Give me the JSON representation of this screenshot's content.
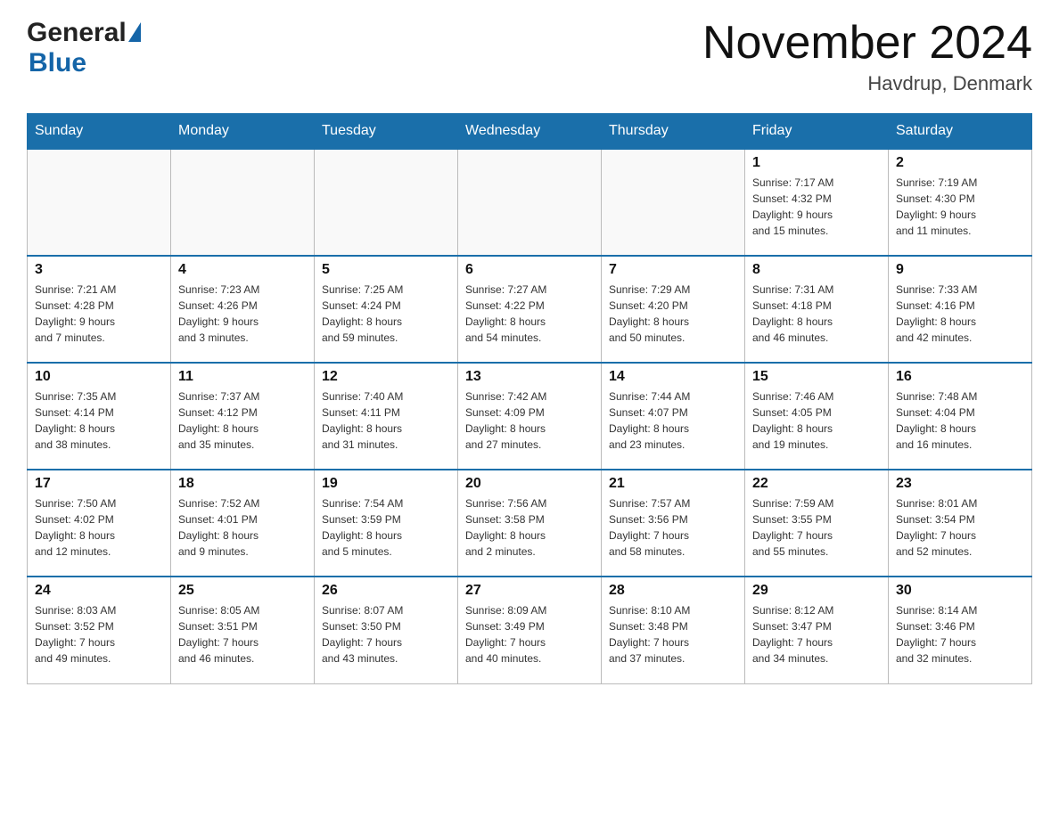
{
  "header": {
    "logo_general": "General",
    "logo_blue": "Blue",
    "month_year": "November 2024",
    "location": "Havdrup, Denmark"
  },
  "weekdays": [
    "Sunday",
    "Monday",
    "Tuesday",
    "Wednesday",
    "Thursday",
    "Friday",
    "Saturday"
  ],
  "weeks": [
    [
      {
        "day": "",
        "info": ""
      },
      {
        "day": "",
        "info": ""
      },
      {
        "day": "",
        "info": ""
      },
      {
        "day": "",
        "info": ""
      },
      {
        "day": "",
        "info": ""
      },
      {
        "day": "1",
        "info": "Sunrise: 7:17 AM\nSunset: 4:32 PM\nDaylight: 9 hours\nand 15 minutes."
      },
      {
        "day": "2",
        "info": "Sunrise: 7:19 AM\nSunset: 4:30 PM\nDaylight: 9 hours\nand 11 minutes."
      }
    ],
    [
      {
        "day": "3",
        "info": "Sunrise: 7:21 AM\nSunset: 4:28 PM\nDaylight: 9 hours\nand 7 minutes."
      },
      {
        "day": "4",
        "info": "Sunrise: 7:23 AM\nSunset: 4:26 PM\nDaylight: 9 hours\nand 3 minutes."
      },
      {
        "day": "5",
        "info": "Sunrise: 7:25 AM\nSunset: 4:24 PM\nDaylight: 8 hours\nand 59 minutes."
      },
      {
        "day": "6",
        "info": "Sunrise: 7:27 AM\nSunset: 4:22 PM\nDaylight: 8 hours\nand 54 minutes."
      },
      {
        "day": "7",
        "info": "Sunrise: 7:29 AM\nSunset: 4:20 PM\nDaylight: 8 hours\nand 50 minutes."
      },
      {
        "day": "8",
        "info": "Sunrise: 7:31 AM\nSunset: 4:18 PM\nDaylight: 8 hours\nand 46 minutes."
      },
      {
        "day": "9",
        "info": "Sunrise: 7:33 AM\nSunset: 4:16 PM\nDaylight: 8 hours\nand 42 minutes."
      }
    ],
    [
      {
        "day": "10",
        "info": "Sunrise: 7:35 AM\nSunset: 4:14 PM\nDaylight: 8 hours\nand 38 minutes."
      },
      {
        "day": "11",
        "info": "Sunrise: 7:37 AM\nSunset: 4:12 PM\nDaylight: 8 hours\nand 35 minutes."
      },
      {
        "day": "12",
        "info": "Sunrise: 7:40 AM\nSunset: 4:11 PM\nDaylight: 8 hours\nand 31 minutes."
      },
      {
        "day": "13",
        "info": "Sunrise: 7:42 AM\nSunset: 4:09 PM\nDaylight: 8 hours\nand 27 minutes."
      },
      {
        "day": "14",
        "info": "Sunrise: 7:44 AM\nSunset: 4:07 PM\nDaylight: 8 hours\nand 23 minutes."
      },
      {
        "day": "15",
        "info": "Sunrise: 7:46 AM\nSunset: 4:05 PM\nDaylight: 8 hours\nand 19 minutes."
      },
      {
        "day": "16",
        "info": "Sunrise: 7:48 AM\nSunset: 4:04 PM\nDaylight: 8 hours\nand 16 minutes."
      }
    ],
    [
      {
        "day": "17",
        "info": "Sunrise: 7:50 AM\nSunset: 4:02 PM\nDaylight: 8 hours\nand 12 minutes."
      },
      {
        "day": "18",
        "info": "Sunrise: 7:52 AM\nSunset: 4:01 PM\nDaylight: 8 hours\nand 9 minutes."
      },
      {
        "day": "19",
        "info": "Sunrise: 7:54 AM\nSunset: 3:59 PM\nDaylight: 8 hours\nand 5 minutes."
      },
      {
        "day": "20",
        "info": "Sunrise: 7:56 AM\nSunset: 3:58 PM\nDaylight: 8 hours\nand 2 minutes."
      },
      {
        "day": "21",
        "info": "Sunrise: 7:57 AM\nSunset: 3:56 PM\nDaylight: 7 hours\nand 58 minutes."
      },
      {
        "day": "22",
        "info": "Sunrise: 7:59 AM\nSunset: 3:55 PM\nDaylight: 7 hours\nand 55 minutes."
      },
      {
        "day": "23",
        "info": "Sunrise: 8:01 AM\nSunset: 3:54 PM\nDaylight: 7 hours\nand 52 minutes."
      }
    ],
    [
      {
        "day": "24",
        "info": "Sunrise: 8:03 AM\nSunset: 3:52 PM\nDaylight: 7 hours\nand 49 minutes."
      },
      {
        "day": "25",
        "info": "Sunrise: 8:05 AM\nSunset: 3:51 PM\nDaylight: 7 hours\nand 46 minutes."
      },
      {
        "day": "26",
        "info": "Sunrise: 8:07 AM\nSunset: 3:50 PM\nDaylight: 7 hours\nand 43 minutes."
      },
      {
        "day": "27",
        "info": "Sunrise: 8:09 AM\nSunset: 3:49 PM\nDaylight: 7 hours\nand 40 minutes."
      },
      {
        "day": "28",
        "info": "Sunrise: 8:10 AM\nSunset: 3:48 PM\nDaylight: 7 hours\nand 37 minutes."
      },
      {
        "day": "29",
        "info": "Sunrise: 8:12 AM\nSunset: 3:47 PM\nDaylight: 7 hours\nand 34 minutes."
      },
      {
        "day": "30",
        "info": "Sunrise: 8:14 AM\nSunset: 3:46 PM\nDaylight: 7 hours\nand 32 minutes."
      }
    ]
  ]
}
